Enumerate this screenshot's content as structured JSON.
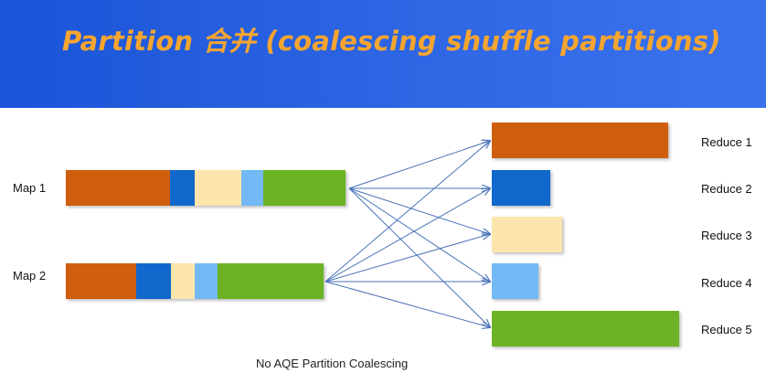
{
  "header": {
    "title": "Partition 合并 (coalescing shuffle partitions)"
  },
  "colors": {
    "header_bg": "#2a62e2",
    "title": "#f6a530",
    "p1": "#cf5e0e",
    "p2": "#1068cc",
    "p3": "#fce6ae",
    "p4": "#72b9f5",
    "p5": "#6bb324",
    "arrow": "#4a72b8"
  },
  "maps": [
    {
      "label": "Map 1"
    },
    {
      "label": "Map 2"
    }
  ],
  "reduces": [
    {
      "label": "Reduce 1"
    },
    {
      "label": "Reduce 2"
    },
    {
      "label": "Reduce 3"
    },
    {
      "label": "Reduce 4"
    },
    {
      "label": "Reduce 5"
    }
  ],
  "caption": "No AQE Partition Coalescing"
}
